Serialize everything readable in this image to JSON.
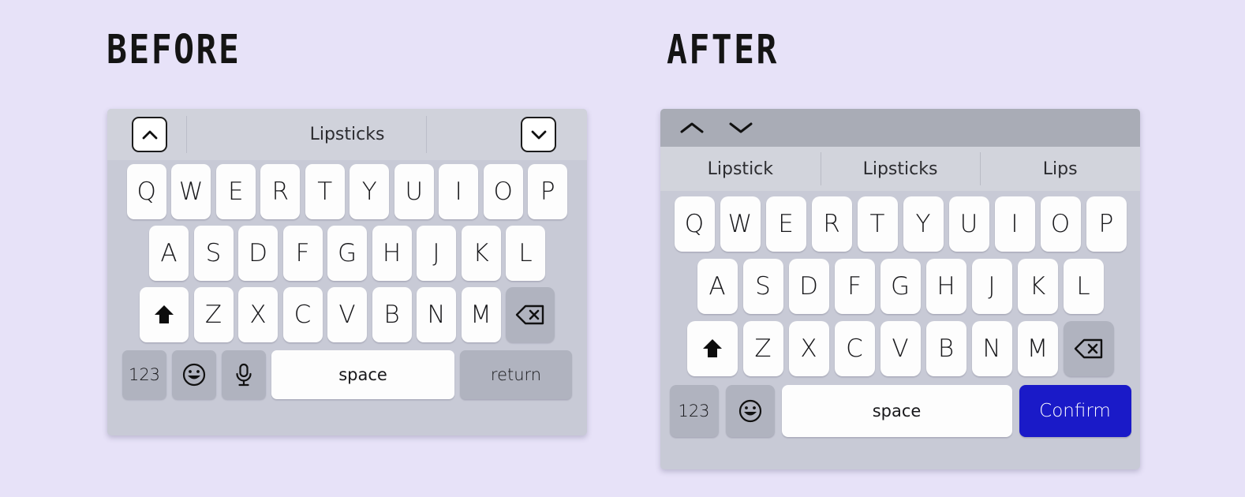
{
  "page": {
    "background_color": "#e7e2f8"
  },
  "labels": {
    "before": "BEFORE",
    "after": "AFTER"
  },
  "before_keyboard": {
    "suggestion_bar": {
      "word": "Lipsticks",
      "prev_icon": "chevron-up-icon",
      "next_icon": "chevron-down-icon"
    },
    "rows": {
      "row1": [
        "Q",
        "W",
        "E",
        "R",
        "T",
        "Y",
        "U",
        "I",
        "O",
        "P"
      ],
      "row2": [
        "A",
        "S",
        "D",
        "F",
        "G",
        "H",
        "J",
        "K",
        "L"
      ],
      "row3_letters": [
        "Z",
        "X",
        "C",
        "V",
        "B",
        "N",
        "M"
      ],
      "shift_icon": "shift-arrow-up-icon",
      "backspace_icon": "backspace-delete-icon"
    },
    "bottom_row": {
      "numeric": "123",
      "emoji_icon": "smiley-face-icon",
      "mic_icon": "microphone-icon",
      "space": "space",
      "action": "return"
    },
    "colors": {
      "panel": "#c8cad6",
      "suggestion_bar": "#d0d2db",
      "key": "#fdfdfd",
      "key_gray": "#b0b3bf"
    }
  },
  "after_keyboard": {
    "nav_bar": {
      "prev_icon": "chevron-up-icon",
      "next_icon": "chevron-down-icon"
    },
    "suggestions": [
      "Lipstick",
      "Lipsticks",
      "Lips"
    ],
    "rows": {
      "row1": [
        "Q",
        "W",
        "E",
        "R",
        "T",
        "Y",
        "U",
        "I",
        "O",
        "P"
      ],
      "row2": [
        "A",
        "S",
        "D",
        "F",
        "G",
        "H",
        "J",
        "K",
        "L"
      ],
      "row3_letters": [
        "Z",
        "X",
        "C",
        "V",
        "B",
        "N",
        "M"
      ],
      "shift_icon": "shift-arrow-up-icon",
      "backspace_icon": "backspace-delete-icon"
    },
    "bottom_row": {
      "numeric": "123",
      "emoji_icon": "smiley-face-icon",
      "space": "space",
      "action": "Confirm"
    },
    "colors": {
      "panel": "#c8cad6",
      "nav_bar": "#a9acb6",
      "suggestion_bar": "#d2d4dc",
      "key": "#fdfdfd",
      "key_gray": "#b0b3bf",
      "confirm_button": "#1a1ac8"
    }
  }
}
